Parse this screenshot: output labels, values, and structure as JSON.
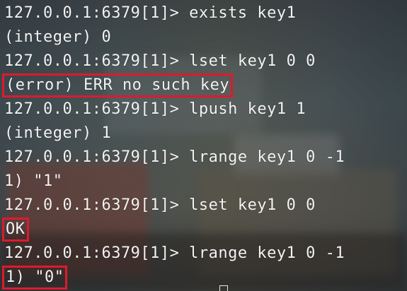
{
  "terminal": {
    "lines": [
      {
        "text": "127.0.0.1:6379[1]> exists key1",
        "highlighted": false
      },
      {
        "text": "(integer) 0",
        "highlighted": false
      },
      {
        "text": "127.0.0.1:6379[1]> lset key1 0 0",
        "highlighted": false
      },
      {
        "text": "(error) ERR no such key",
        "highlighted": true
      },
      {
        "text": "127.0.0.1:6379[1]> lpush key1 1",
        "highlighted": false
      },
      {
        "text": "(integer) 1",
        "highlighted": false
      },
      {
        "text": "127.0.0.1:6379[1]> lrange key1 0 -1",
        "highlighted": false
      },
      {
        "text": "1) \"1\"",
        "highlighted": false
      },
      {
        "text": "127.0.0.1:6379[1]> lset key1 0 0",
        "highlighted": false
      },
      {
        "text": "OK",
        "highlighted": true
      },
      {
        "text": "127.0.0.1:6379[1]> lrange key1 0 -1",
        "highlighted": false
      },
      {
        "text": "1) \"0\"",
        "highlighted": true
      }
    ],
    "highlight_color": "#e0192d",
    "text_color": "#f4f4f4"
  }
}
